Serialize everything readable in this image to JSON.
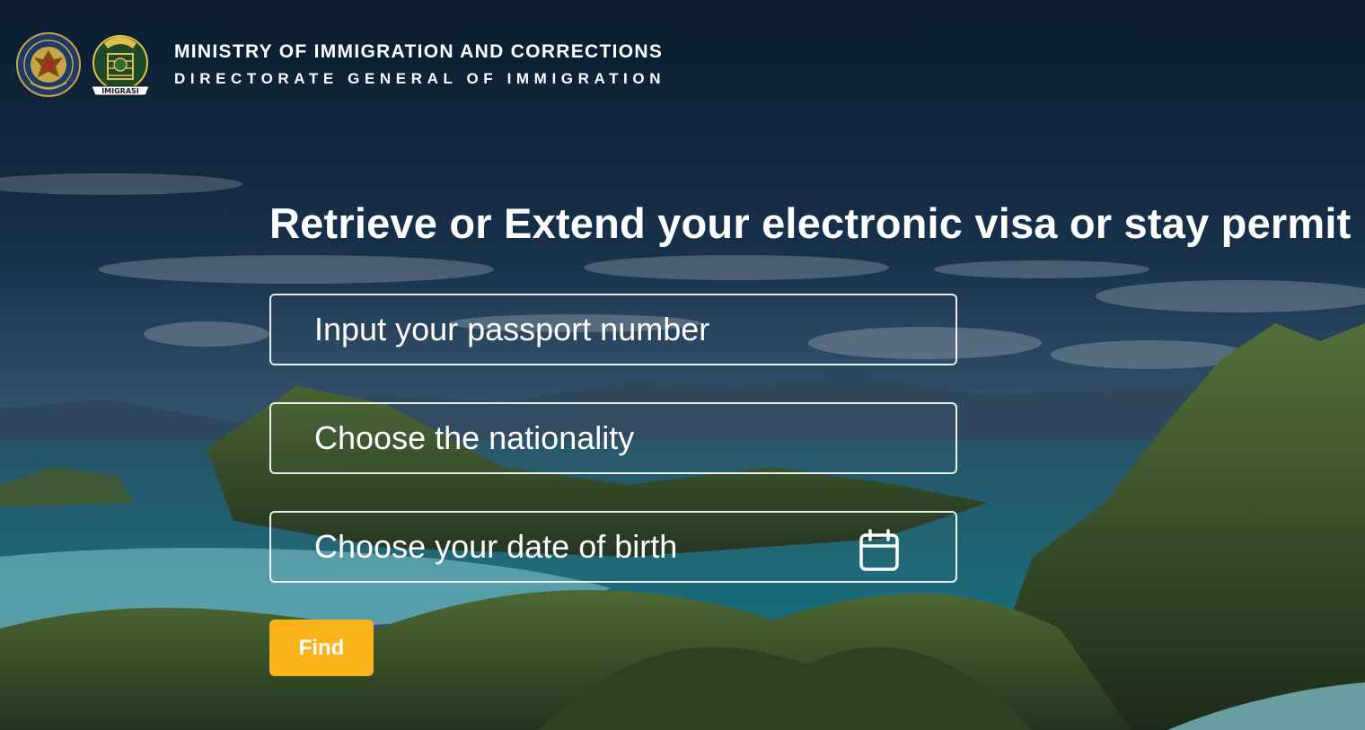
{
  "header": {
    "ministry": "MINISTRY OF IMMIGRATION AND CORRECTIONS",
    "directorate": "DIRECTORATE GENERAL OF IMMIGRATION",
    "logos": [
      "republic-emblem-logo",
      "imigrasi-logo"
    ]
  },
  "main": {
    "title": "Retrieve or Extend your electronic visa or stay permit",
    "fields": {
      "passport_placeholder": "Input your passport number",
      "nationality_placeholder": "Choose the nationality",
      "dob_placeholder": "Choose your date of birth"
    },
    "find_label": "Find"
  },
  "colors": {
    "accent": "#fbb31a",
    "overlay": "#0e2a44"
  }
}
